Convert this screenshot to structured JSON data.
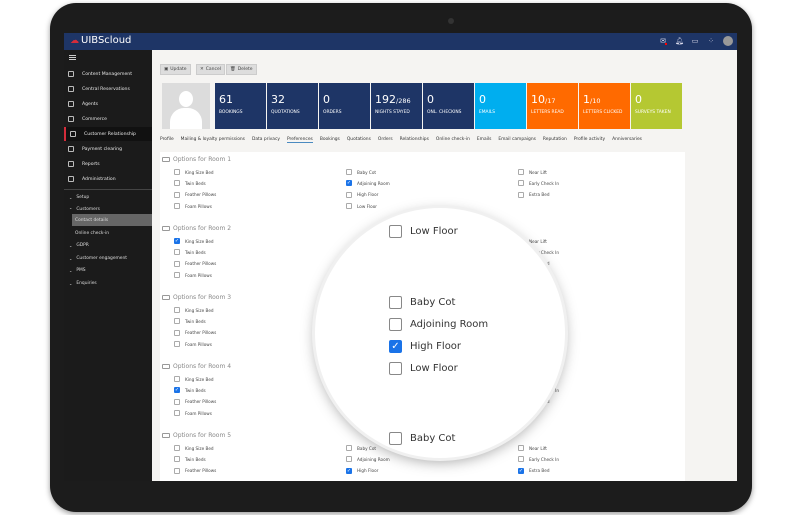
{
  "app": {
    "logo_text": "UIBScloud",
    "brand_color": "#1e3566",
    "accent_red": "#d42c3a"
  },
  "topbar_icons": [
    "mail-icon",
    "bell-icon",
    "folder-icon",
    "grid-icon",
    "user-avatar-icon"
  ],
  "sidebar": {
    "items": [
      {
        "label": "Content Management",
        "icon": "content-icon"
      },
      {
        "label": "Central Reservations",
        "icon": "calendar-icon"
      },
      {
        "label": "Agents",
        "icon": "headset-icon"
      },
      {
        "label": "Commerce",
        "icon": "cart-icon"
      },
      {
        "label": "Customer Relationship",
        "icon": "person-icon",
        "active": true
      },
      {
        "label": "Payment clearing",
        "icon": "card-icon"
      },
      {
        "label": "Reports",
        "icon": "chart-icon"
      },
      {
        "label": "Administration",
        "icon": "gear-icon"
      }
    ],
    "subitems": [
      {
        "label": "Setup",
        "chevron": "down"
      },
      {
        "label": "Customers",
        "chevron": "up"
      },
      {
        "label": "Contact details",
        "highlighted": true
      },
      {
        "label": "Online check-in"
      },
      {
        "label": "GDPR",
        "chevron": "down"
      },
      {
        "label": "Customer engagement",
        "chevron": "down"
      },
      {
        "label": "PMS",
        "chevron": "down"
      },
      {
        "label": "Enquiries",
        "chevron": "down"
      }
    ]
  },
  "toolbar": {
    "update": "Update",
    "cancel": "Cancel",
    "delete": "Delete"
  },
  "stats": [
    {
      "value": "61",
      "total": "",
      "label": "BOOKINGS",
      "color": "#1e3566"
    },
    {
      "value": "32",
      "total": "",
      "label": "QUOTATIONS",
      "color": "#1e3566"
    },
    {
      "value": "0",
      "total": "",
      "label": "ORDERS",
      "color": "#1e3566"
    },
    {
      "value": "192",
      "total": "/286",
      "label": "NIGHTS STAYED",
      "color": "#1e3566"
    },
    {
      "value": "0",
      "total": "",
      "label": "ONL. CHECKINS",
      "color": "#1e3566"
    },
    {
      "value": "0",
      "total": "",
      "label": "EMAILS",
      "color": "#00aeef"
    },
    {
      "value": "10",
      "total": "/17",
      "label": "LETTERS READ",
      "color": "#ff6a00"
    },
    {
      "value": "1",
      "total": "/10",
      "label": "LETTERS CLICKED",
      "color": "#ff6a00"
    },
    {
      "value": "0",
      "total": "",
      "label": "SURVEYS TAKEN",
      "color": "#b5c832"
    }
  ],
  "tabs": [
    "Profile",
    "Mailing & loyalty permissions",
    "Data privacy",
    "Preferences",
    "Bookings",
    "Quotations",
    "Orders",
    "Relationships",
    "Online check-in",
    "Emails",
    "Email campaigns",
    "Reputation",
    "Profile activity",
    "Anniversaries"
  ],
  "active_tab": "Preferences",
  "rooms": [
    {
      "title": "Options for Room 1",
      "left": [
        [
          "King Size Bed",
          false
        ],
        [
          "Twin Beds",
          false
        ],
        [
          "Feather Pillows",
          false
        ],
        [
          "Foam Pillows",
          false
        ]
      ],
      "middle": [
        [
          "Baby Cot",
          false
        ],
        [
          "Adjoining Room",
          true
        ],
        [
          "High Floor",
          false
        ],
        [
          "Low Floor",
          false
        ]
      ],
      "right": [
        [
          "Near Lift",
          false
        ],
        [
          "Early Check In",
          false
        ],
        [
          "Extra Bed",
          false
        ]
      ]
    },
    {
      "title": "Options for Room 2",
      "left": [
        [
          "King Size Bed",
          true
        ],
        [
          "Twin Beds",
          false
        ],
        [
          "Feather Pillows",
          false
        ],
        [
          "Foam Pillows",
          false
        ]
      ],
      "middle": [],
      "right": [
        [
          "Near Lift",
          false
        ],
        [
          "Early Check In",
          false
        ],
        [
          "Extra Bed",
          true
        ]
      ]
    },
    {
      "title": "Options for Room 3",
      "left": [
        [
          "King Size Bed",
          false
        ],
        [
          "Twin Beds",
          false
        ],
        [
          "Feather Pillows",
          false
        ],
        [
          "Foam Pillows",
          false
        ]
      ],
      "middle": [],
      "right": [
        [
          "Near Lift",
          false
        ],
        [
          "Early Check In",
          true
        ],
        [
          "Extra Bed",
          false
        ]
      ]
    },
    {
      "title": "Options for Room 4",
      "left": [
        [
          "King Size Bed",
          false
        ],
        [
          "Twin Beds",
          true
        ],
        [
          "Feather Pillows",
          false
        ],
        [
          "Foam Pillows",
          false
        ]
      ],
      "middle": [],
      "right": [
        [
          "Near Lift",
          false
        ],
        [
          "Early Check In",
          false
        ],
        [
          "Extra Bed",
          false
        ]
      ]
    },
    {
      "title": "Options for Room 5",
      "left": [
        [
          "King Size Bed",
          false
        ],
        [
          "Twin Beds",
          false
        ],
        [
          "Feather Pillows",
          false
        ]
      ],
      "middle": [
        [
          "Baby Cot",
          false
        ],
        [
          "Adjoining Room",
          false
        ],
        [
          "High Floor",
          true
        ]
      ],
      "right": [
        [
          "Near Lift",
          false
        ],
        [
          "Early Check In",
          false
        ],
        [
          "Extra Bed",
          true
        ]
      ]
    }
  ],
  "magnifier": [
    {
      "label": "Low Floor",
      "checked": false
    },
    {
      "label": "Baby Cot",
      "checked": false
    },
    {
      "label": "Adjoining Room",
      "checked": false
    },
    {
      "label": "High Floor",
      "checked": true
    },
    {
      "label": "Low Floor",
      "checked": false
    },
    {
      "label": "Baby Cot",
      "checked": false
    }
  ]
}
